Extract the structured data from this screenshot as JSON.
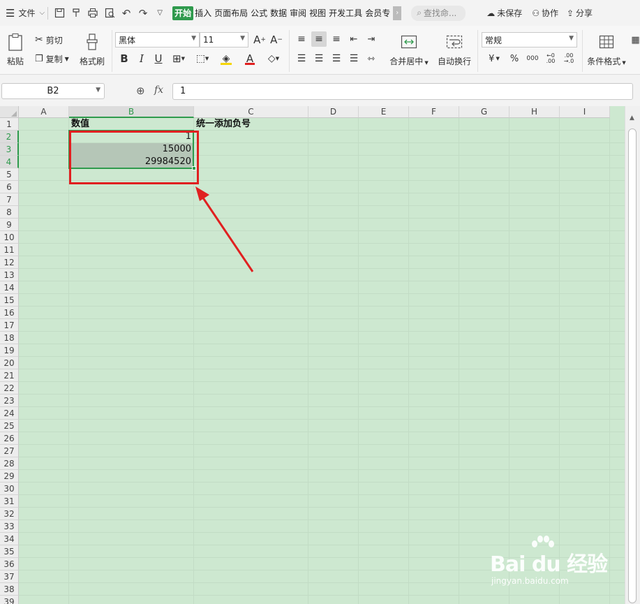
{
  "menubar": {
    "file_label": "文件",
    "tabs": [
      {
        "label": "开始",
        "active": true
      },
      {
        "label": "插入"
      },
      {
        "label": "页面布局"
      },
      {
        "label": "公式"
      },
      {
        "label": "数据"
      },
      {
        "label": "审阅"
      },
      {
        "label": "视图"
      },
      {
        "label": "开发工具"
      },
      {
        "label": "会员专享"
      }
    ],
    "search_placeholder": "查找命...",
    "unsaved_label": "未保存",
    "collab_label": "协作",
    "share_label": "分享"
  },
  "ribbon": {
    "paste_label": "粘贴",
    "cut_label": "剪切",
    "copy_label": "复制",
    "format_painter_label": "格式刷",
    "font_name": "黑体",
    "font_size": "11",
    "merge_label": "合并居中",
    "wrap_label": "自动换行",
    "number_format": "常规",
    "currency_symbol": "¥",
    "percent_symbol": "%",
    "thousands_symbol": "000",
    "cond_format_label": "条件格式"
  },
  "formula_bar": {
    "cell_ref": "B2",
    "fx_label": "fx",
    "formula_value": "1"
  },
  "sheet": {
    "columns": [
      "A",
      "B",
      "C",
      "D",
      "E",
      "F",
      "G",
      "H",
      "I"
    ],
    "selected_column": "B",
    "rows": [
      "1",
      "2",
      "3",
      "4",
      "5",
      "6",
      "7",
      "8",
      "9",
      "10",
      "11",
      "12",
      "13",
      "14",
      "15",
      "16",
      "17",
      "18",
      "19",
      "20",
      "21",
      "22",
      "23",
      "24",
      "25",
      "26",
      "27",
      "28",
      "29",
      "30",
      "31",
      "32",
      "33",
      "34",
      "35",
      "36",
      "37",
      "38",
      "39"
    ],
    "selected_rows": [
      "2",
      "3",
      "4"
    ],
    "cells": {
      "B1": "数值",
      "C1": "统一添加负号",
      "B2": "1",
      "B3": "15000",
      "B4": "29984520"
    },
    "grid_color": "#cde8d0",
    "accent": "#2f9a4d",
    "annotation_color": "#e02020"
  },
  "watermark": {
    "brand": "Bai du 经验",
    "url": "jingyan.baidu.com"
  }
}
